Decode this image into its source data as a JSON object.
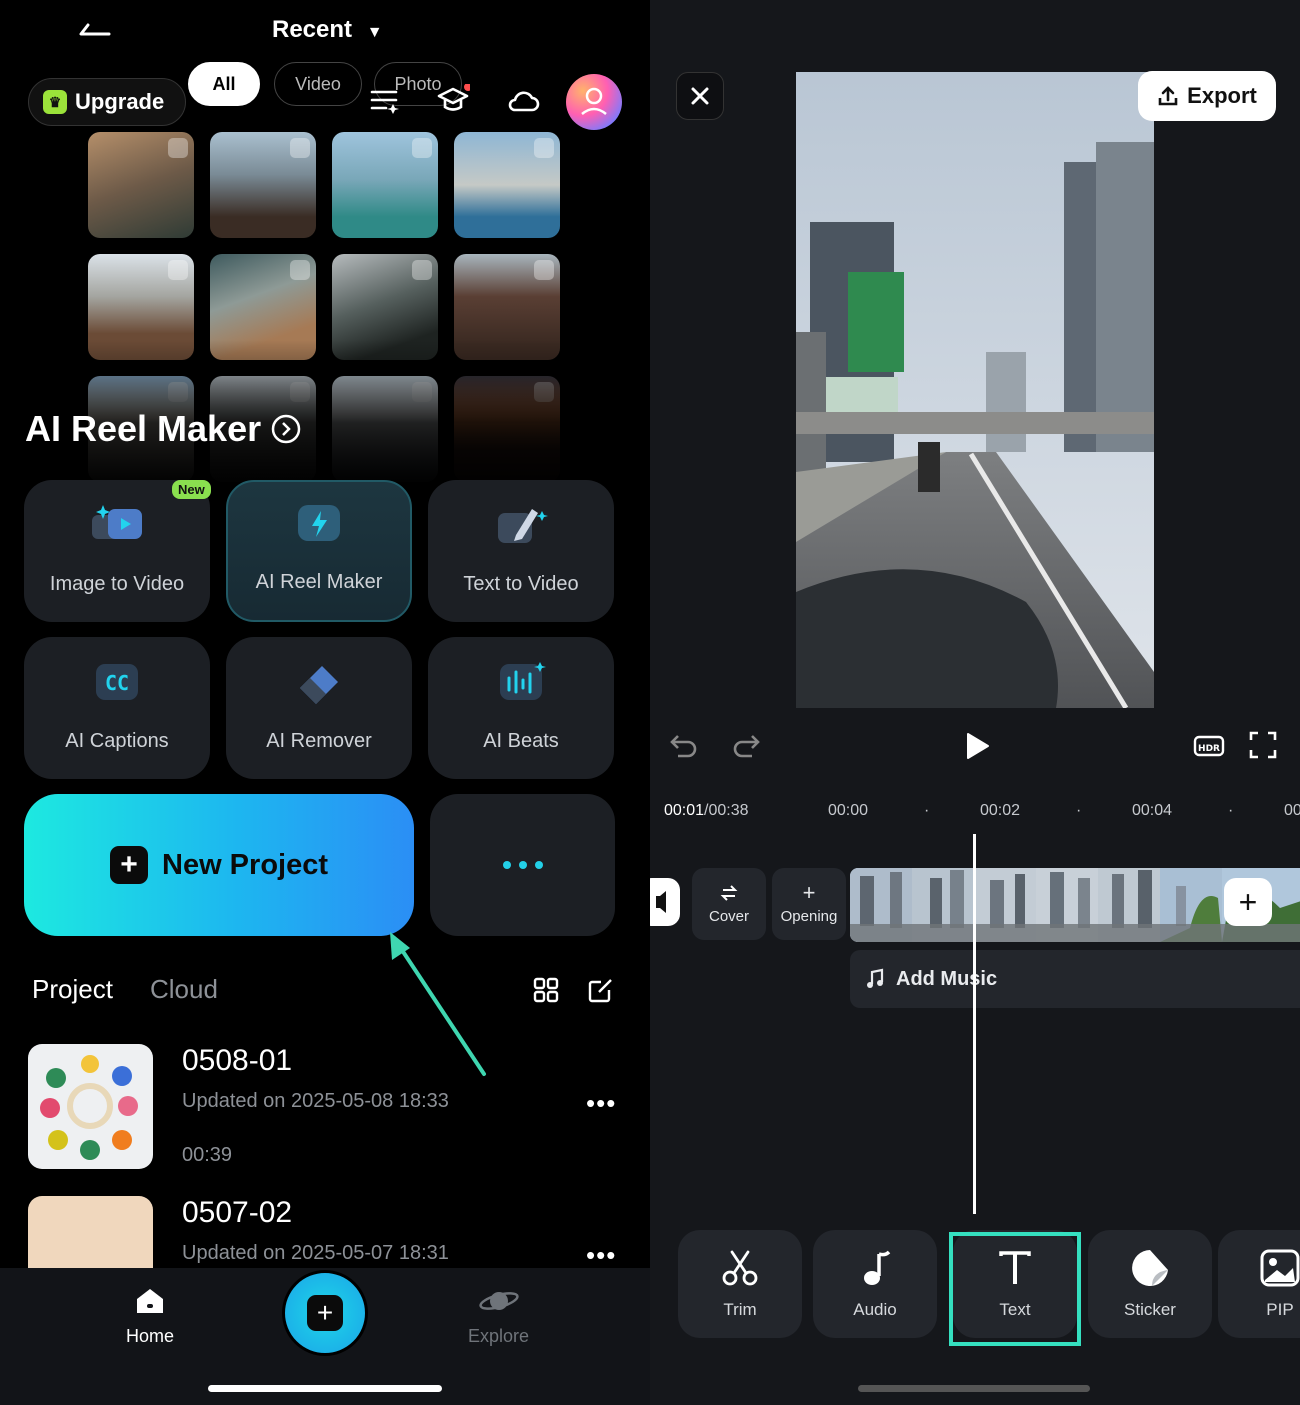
{
  "left": {
    "header_title": "Recent",
    "filters": [
      "All",
      "Video",
      "Photo"
    ],
    "upgrade_label": "Upgrade",
    "section_title": "AI Reel Maker",
    "new_badge": "New",
    "tools": [
      {
        "label": "Image to Video",
        "icon": "image-to-video-icon"
      },
      {
        "label": "AI Reel Maker",
        "icon": "ai-reel-icon"
      },
      {
        "label": "Text to Video",
        "icon": "text-to-video-icon"
      },
      {
        "label": "AI Captions",
        "icon": "cc-icon"
      },
      {
        "label": "AI Remover",
        "icon": "eraser-icon"
      },
      {
        "label": "AI Beats",
        "icon": "beats-icon"
      }
    ],
    "new_project_label": "New Project",
    "tabs": [
      "Project",
      "Cloud"
    ],
    "projects": [
      {
        "name": "0508-01",
        "updated": "Updated on 2025-05-08 18:33",
        "duration": "00:39"
      },
      {
        "name": "0507-02",
        "updated": "Updated on 2025-05-07 18:31",
        "duration": ""
      }
    ],
    "nav": {
      "home": "Home",
      "explore": "Explore"
    }
  },
  "right": {
    "export_label": "Export",
    "current_time": "00:01",
    "total_time": "/00:38",
    "ruler": [
      "00:00",
      "00:02",
      "00:04",
      "00"
    ],
    "cover_label": "Cover",
    "opening_label": "Opening",
    "add_music_label": "Add Music",
    "toolbar": [
      {
        "label": "Trim",
        "icon": "scissors-icon"
      },
      {
        "label": "Audio",
        "icon": "music-note-icon"
      },
      {
        "label": "Text",
        "icon": "text-icon"
      },
      {
        "label": "Sticker",
        "icon": "sticker-icon"
      },
      {
        "label": "PIP",
        "icon": "pip-icon"
      }
    ],
    "highlighted_tool": "Text"
  },
  "colors": {
    "accent": "#1de9e0",
    "highlight": "#35e0c0",
    "arrow": "#3fd6b0"
  }
}
